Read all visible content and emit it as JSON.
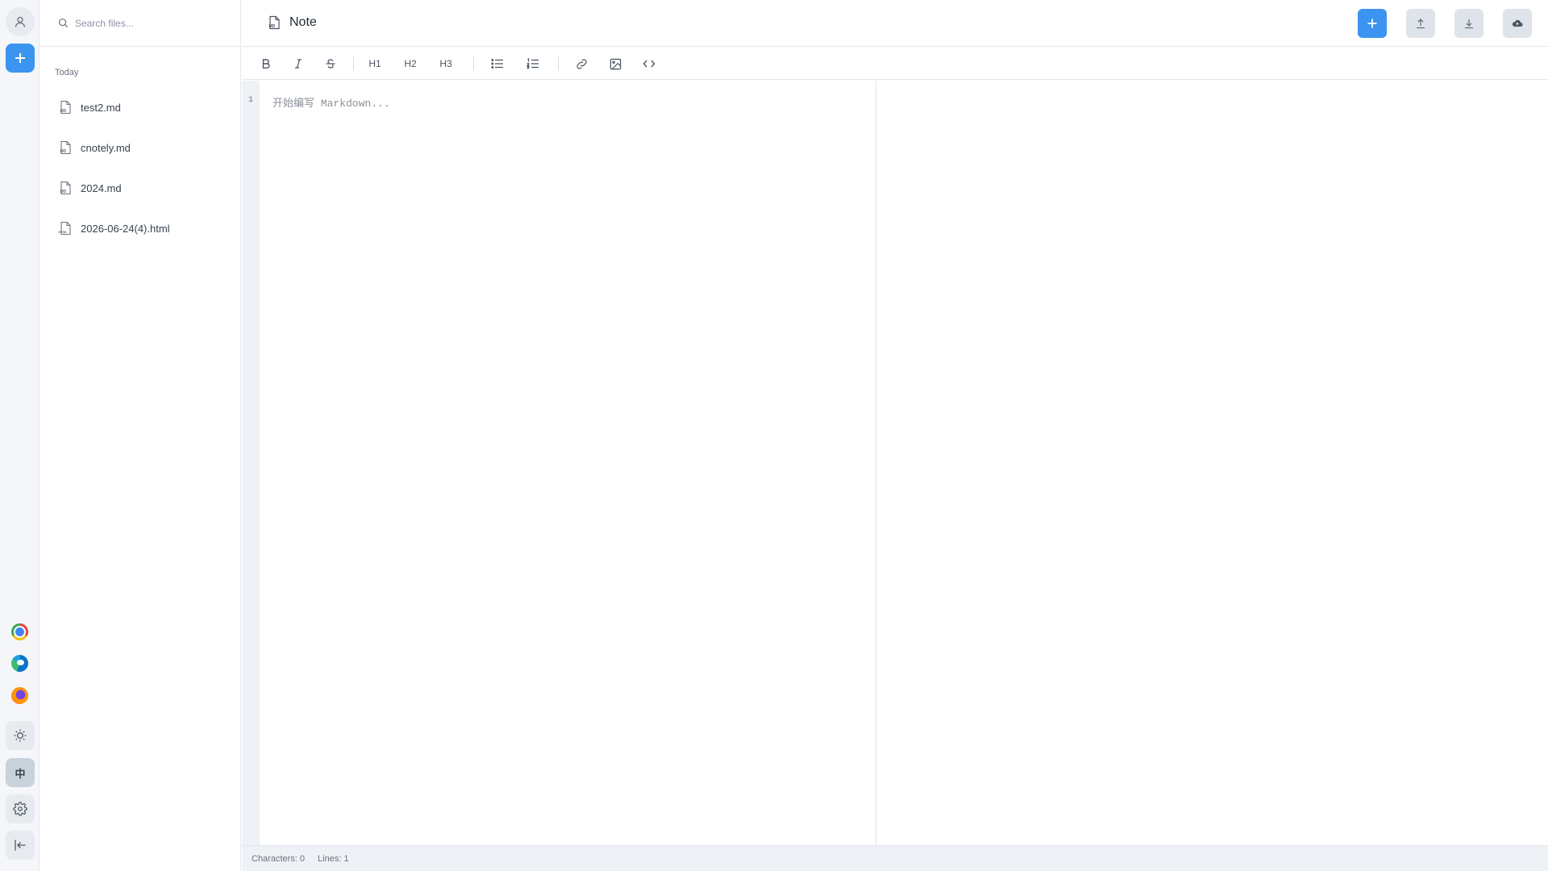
{
  "rail": {
    "lang_label": "中",
    "browsers": [
      "chrome-icon",
      "edge-icon",
      "firefox-icon"
    ]
  },
  "sidebar": {
    "search_placeholder": "Search files...",
    "group_label": "Today",
    "files": [
      {
        "name": "test2.md",
        "type": "MD"
      },
      {
        "name": "cnotely.md",
        "type": "MD"
      },
      {
        "name": "2024.md",
        "type": "MD"
      },
      {
        "name": "2026-06-24(4).html",
        "type": "HTML"
      }
    ]
  },
  "header": {
    "title": "Note",
    "accent_color": "#3b94ef"
  },
  "toolbar": {
    "h1": "H1",
    "h2": "H2",
    "h3": "H3"
  },
  "editor": {
    "line_number": "1",
    "placeholder": "开始编写 Markdown..."
  },
  "status": {
    "characters": "Characters: 0",
    "lines": "Lines: 1"
  }
}
